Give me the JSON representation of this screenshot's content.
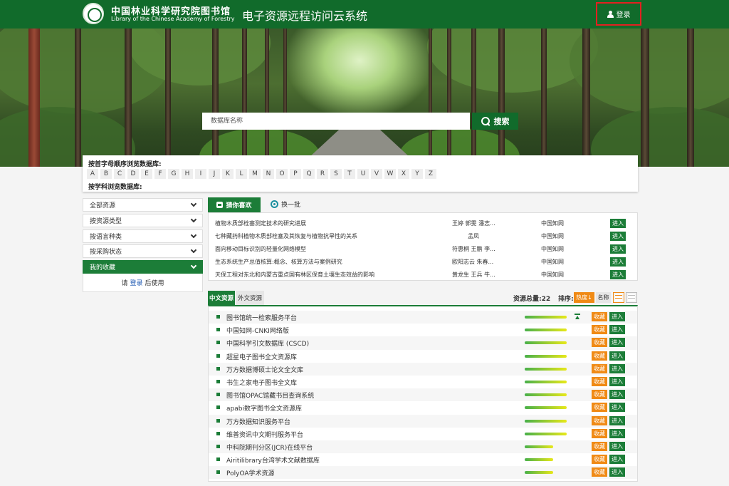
{
  "header": {
    "logo_cn": "中国林业科学研究院图书馆",
    "logo_en": "Library of the Chinese Academy of Forestry",
    "site_title": "电子资源远程访问云系统",
    "login_label": "登录"
  },
  "search": {
    "placeholder": "数据库名称",
    "button_label": "搜索"
  },
  "browse": {
    "alpha_title": "按首字母顺序浏览数据库:",
    "letters": [
      "A",
      "B",
      "C",
      "D",
      "E",
      "F",
      "G",
      "H",
      "I",
      "J",
      "K",
      "L",
      "M",
      "N",
      "O",
      "P",
      "Q",
      "R",
      "S",
      "T",
      "U",
      "V",
      "W",
      "X",
      "Y",
      "Z"
    ],
    "subject_title": "按学科浏览数据库:"
  },
  "sidebar": {
    "items": [
      {
        "label": "全部资源"
      },
      {
        "label": "按资源类型"
      },
      {
        "label": "按语言种类"
      },
      {
        "label": "按采购状态"
      },
      {
        "label": "我的收藏"
      }
    ],
    "fav_prefix": "请",
    "fav_link": "登录",
    "fav_suffix": "后使用"
  },
  "recommend": {
    "tab_label": "猜你喜欢",
    "refresh_label": "换一批",
    "rows": [
      {
        "title": "植物木质部栓塞测定技术的研究进展",
        "authors": "王婷 郭雯 潘志...",
        "source": "中国知网",
        "enter": "进入"
      },
      {
        "title": "七种藏药科植物木质部栓塞及其恢复与植物抗旱性的关系",
        "authors": "孟凤",
        "source": "中国知网",
        "enter": "进入"
      },
      {
        "title": "面向移动目标识别的轻量化网络模型",
        "authors": "符惠桐 王鹏 李...",
        "source": "中国知网",
        "enter": "进入"
      },
      {
        "title": "生态系统生产总值核算:概念、核算方法与案例研究",
        "authors": "欧阳志云 朱春...",
        "source": "中国知网",
        "enter": "进入"
      },
      {
        "title": "天保工程对东北和内蒙古重点国有林区保育土壤生态效益的影响",
        "authors": "黄龙生 王兵 牛...",
        "source": "中国知网",
        "enter": "进入"
      }
    ]
  },
  "resources": {
    "tab_cn": "中文资源",
    "tab_en": "外文资源",
    "total_label": "资源总量:22",
    "sort_label": "排序:",
    "sort_hot": "热度↓",
    "sort_name": "名称",
    "fav_label": "收藏",
    "enter_label": "进入",
    "items": [
      {
        "name": "图书馆统一检索服务平台",
        "popularity": 1.0
      },
      {
        "name": "中国知网-CNKI网络版",
        "popularity": 1.0
      },
      {
        "name": "中国科学引文数据库 (CSCD)",
        "popularity": 1.0
      },
      {
        "name": "超星电子图书全文资源库",
        "popularity": 1.0
      },
      {
        "name": "万方数据博硕士论文全文库",
        "popularity": 1.0
      },
      {
        "name": "书生之家电子图书全文库",
        "popularity": 1.0
      },
      {
        "name": "图书馆OPAC馆藏书目查询系统",
        "popularity": 1.0
      },
      {
        "name": "apabi数字图书全文资源库",
        "popularity": 1.0
      },
      {
        "name": "万方数据知识服务平台",
        "popularity": 1.0
      },
      {
        "name": "维普资讯中文期刊服务平台",
        "popularity": 1.0
      },
      {
        "name": "中科院期刊分区(JCR)在线平台",
        "popularity": 0.68
      },
      {
        "name": "Airitilibrary台湾学术文献数据库",
        "popularity": 0.68
      },
      {
        "name": "PolyOA学术资源",
        "popularity": 0.68
      }
    ]
  }
}
